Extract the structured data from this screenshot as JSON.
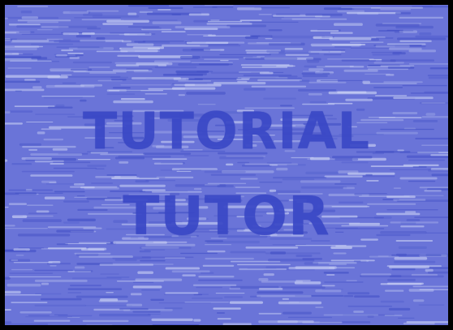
{
  "title": {
    "line1": "TUTORIAL",
    "line2": "TUTOR"
  },
  "colors": {
    "frame": "#000000",
    "background": "#6a74d8",
    "text": "#3a48c6",
    "streak_light": "#c9d0f4",
    "streak_dark": "#3e4cc4"
  }
}
